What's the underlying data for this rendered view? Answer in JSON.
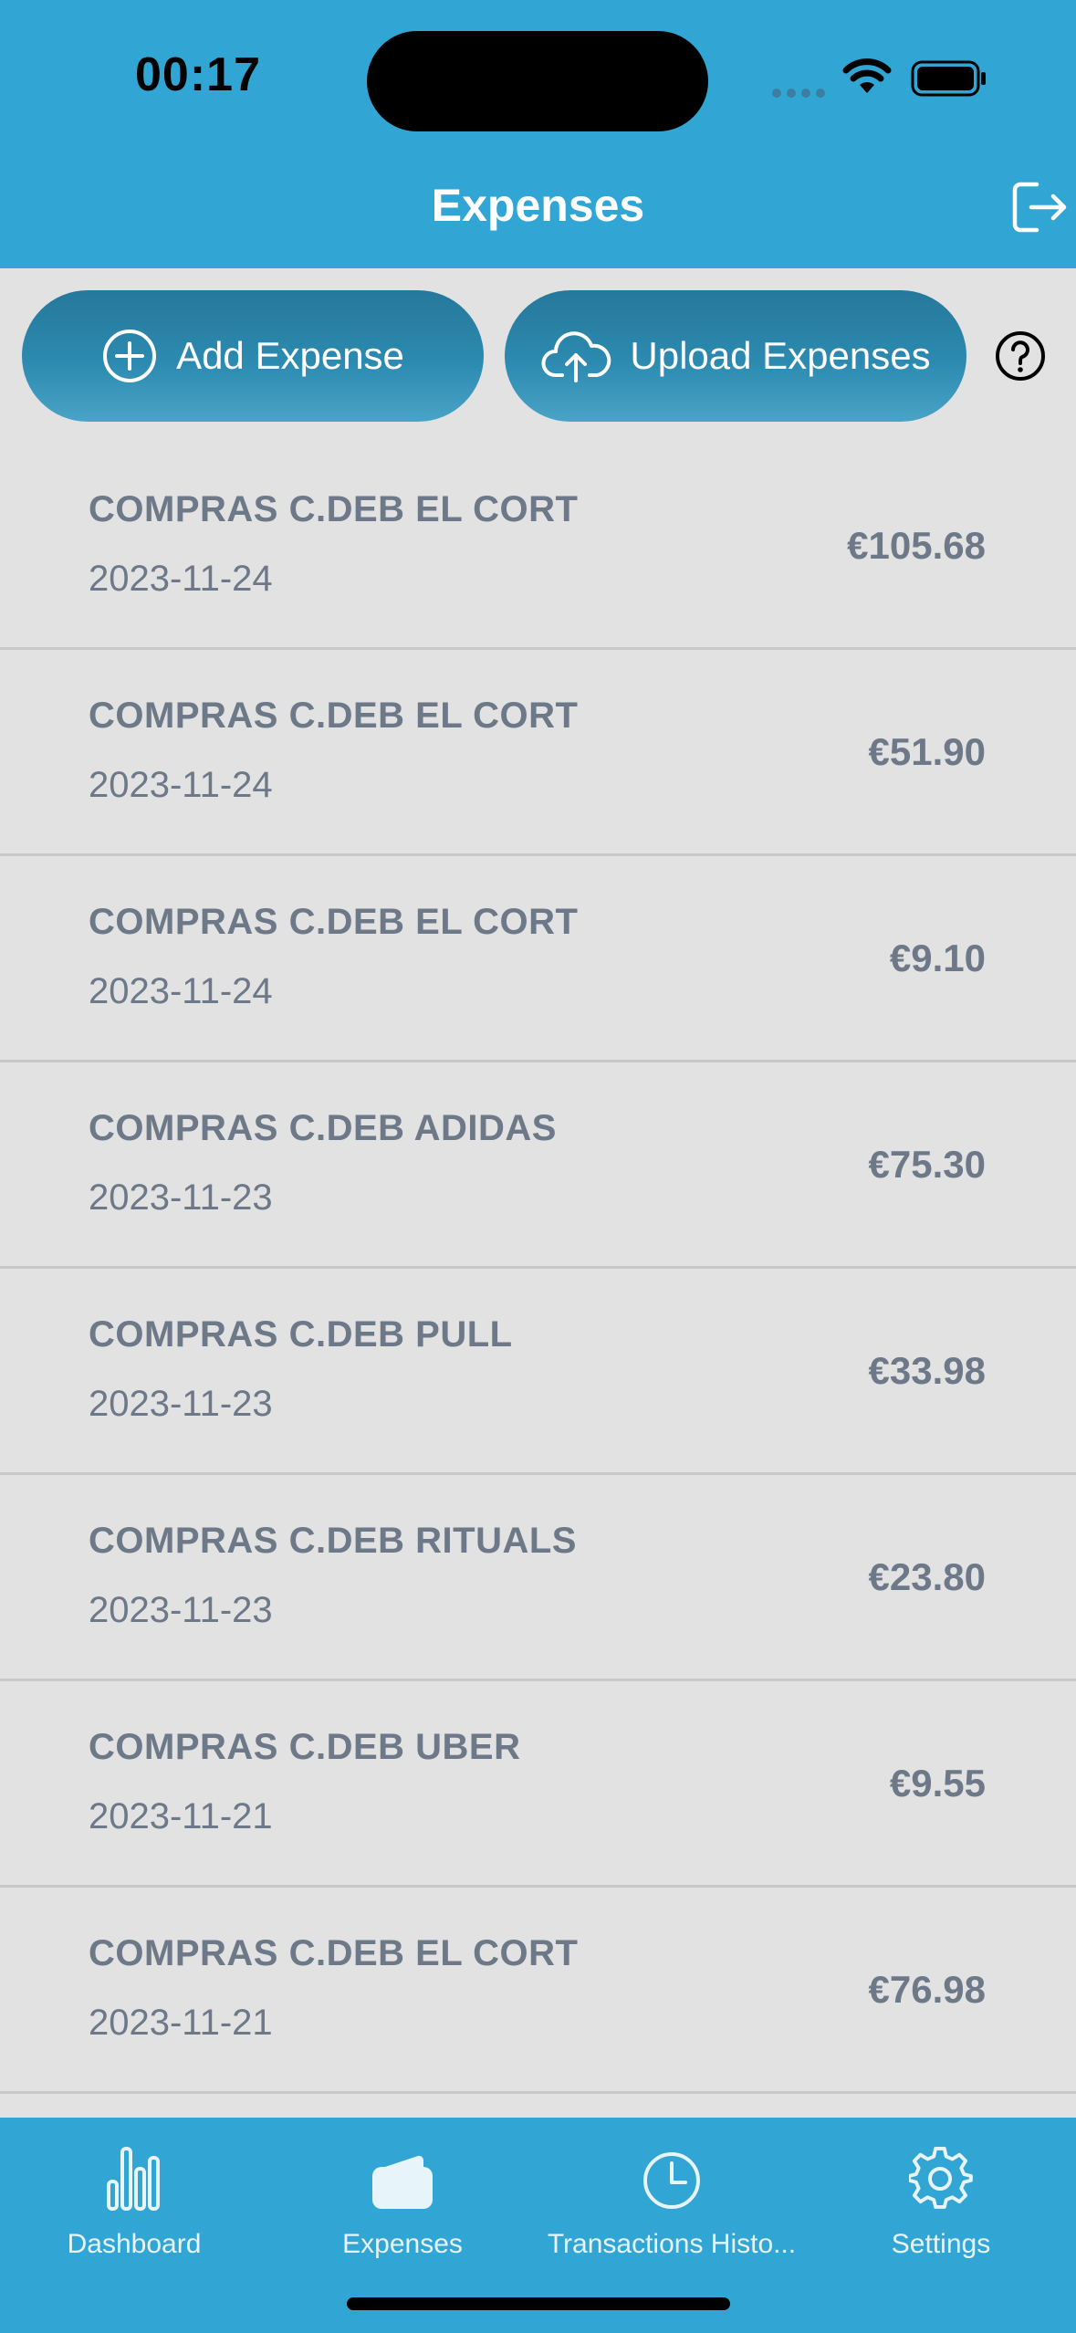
{
  "status_bar": {
    "time": "00:17"
  },
  "header": {
    "title": "Expenses"
  },
  "actions": {
    "add_label": "Add Expense",
    "upload_label": "Upload Expenses"
  },
  "expenses": [
    {
      "name": "COMPRAS C.DEB EL CORT",
      "date": "2023-11-24",
      "amount": "€105.68"
    },
    {
      "name": "COMPRAS C.DEB EL CORT",
      "date": "2023-11-24",
      "amount": "€51.90"
    },
    {
      "name": "COMPRAS C.DEB EL CORT",
      "date": "2023-11-24",
      "amount": "€9.10"
    },
    {
      "name": "COMPRAS C.DEB ADIDAS",
      "date": "2023-11-23",
      "amount": "€75.30"
    },
    {
      "name": "COMPRAS C.DEB PULL",
      "date": "2023-11-23",
      "amount": "€33.98"
    },
    {
      "name": "COMPRAS C.DEB RITUALS",
      "date": "2023-11-23",
      "amount": "€23.80"
    },
    {
      "name": "COMPRAS C.DEB UBER",
      "date": "2023-11-21",
      "amount": "€9.55"
    },
    {
      "name": "COMPRAS C.DEB EL CORT",
      "date": "2023-11-21",
      "amount": "€76.98"
    }
  ],
  "tabs": [
    {
      "label": "Dashboard",
      "icon": "bar-chart-icon"
    },
    {
      "label": "Expenses",
      "icon": "wallet-icon"
    },
    {
      "label": "Transactions Histo...",
      "icon": "clock-icon"
    },
    {
      "label": "Settings",
      "icon": "gear-icon"
    }
  ],
  "colors": {
    "header": "#31a6d4",
    "button_gradient_top": "#26789b",
    "list_background": "#e2e2e2",
    "text": "#6d7888"
  }
}
